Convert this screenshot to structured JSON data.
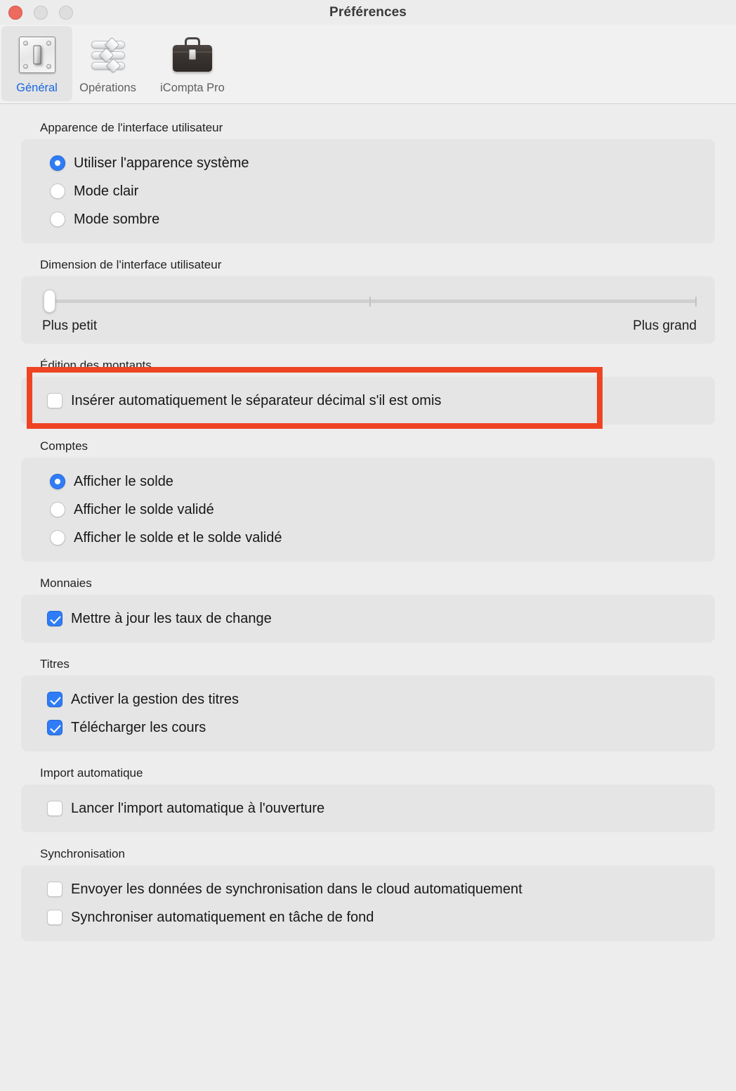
{
  "window": {
    "title": "Préférences",
    "traffic_lights": [
      "close",
      "minimize",
      "maximize"
    ]
  },
  "toolbar": {
    "items": [
      {
        "label": "Général",
        "icon": "light-switch-icon",
        "selected": true
      },
      {
        "label": "Opérations",
        "icon": "sliders-icon",
        "selected": false
      },
      {
        "label": "iCompta Pro",
        "icon": "briefcase-icon",
        "selected": false
      }
    ]
  },
  "sections": {
    "appearance": {
      "label": "Apparence de l'interface utilisateur",
      "options": [
        {
          "label": "Utiliser l'apparence système",
          "selected": true
        },
        {
          "label": "Mode clair",
          "selected": false
        },
        {
          "label": "Mode sombre",
          "selected": false
        }
      ]
    },
    "size": {
      "label": "Dimension de l'interface utilisateur",
      "min_label": "Plus petit",
      "max_label": "Plus grand",
      "value": 0,
      "min": 0,
      "max": 100,
      "ticks": [
        50,
        100
      ]
    },
    "amount_editing": {
      "label": "Édition des montants",
      "highlighted": true,
      "highlight_color": "#ee4423",
      "options": [
        {
          "label": "Insérer automatiquement le séparateur décimal s'il est omis",
          "checked": false
        }
      ]
    },
    "accounts": {
      "label": "Comptes",
      "options": [
        {
          "label": "Afficher le solde",
          "selected": true
        },
        {
          "label": "Afficher le solde validé",
          "selected": false
        },
        {
          "label": "Afficher le solde et le solde validé",
          "selected": false
        }
      ]
    },
    "currencies": {
      "label": "Monnaies",
      "options": [
        {
          "label": "Mettre à jour les taux de change",
          "checked": true
        }
      ]
    },
    "securities": {
      "label": "Titres",
      "options": [
        {
          "label": "Activer la gestion des titres",
          "checked": true
        },
        {
          "label": "Télécharger les cours",
          "checked": true
        }
      ]
    },
    "auto_import": {
      "label": "Import automatique",
      "options": [
        {
          "label": "Lancer l'import automatique à l'ouverture",
          "checked": false
        }
      ]
    },
    "sync": {
      "label": "Synchronisation",
      "options": [
        {
          "label": "Envoyer les données de synchronisation dans le cloud automatiquement",
          "checked": false
        },
        {
          "label": "Synchroniser automatiquement en tâche de fond",
          "checked": false
        }
      ]
    }
  },
  "colors": {
    "accent_blue": "#2f7cf6",
    "tab_active_text": "#1a66e0",
    "annotation_red": "#ee4423",
    "window_bg": "#ededed",
    "group_bg": "#e5e5e5"
  }
}
